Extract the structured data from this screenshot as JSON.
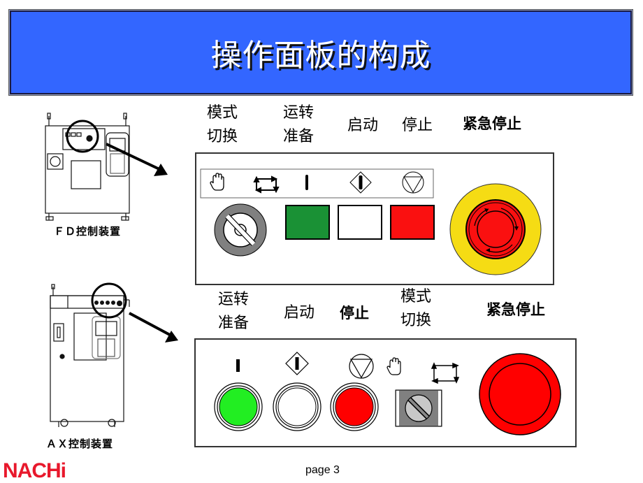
{
  "title": "操作面板的构成",
  "fd_section": {
    "caption": "ＦＤ控制装置",
    "labels": {
      "mode_switch": [
        "模式",
        "切换"
      ],
      "ready": [
        "运转",
        "准备"
      ],
      "start": "启动",
      "stop": "停止",
      "emergency_stop": "紧急停止"
    },
    "controls": [
      {
        "name": "mode-key-switch",
        "icon": "hand-icon",
        "color": "#808080"
      },
      {
        "name": "ready-button",
        "icon": "cycle-arrows-icon",
        "color": "#1a9135"
      },
      {
        "name": "start-button",
        "icon": "start-bar-icon",
        "color": "#ffffff"
      },
      {
        "name": "stop-button",
        "icon": "stop-triangle-icon",
        "color": "#fa1010"
      }
    ],
    "emergency": {
      "ring_color": "#f5dc14",
      "button_color": "#fa1010"
    }
  },
  "ax_section": {
    "caption": "ＡＸ控制装置",
    "labels": {
      "ready": [
        "运转",
        "准备"
      ],
      "start": "启动",
      "stop": "停止",
      "mode_switch": [
        "模式",
        "切换"
      ],
      "emergency_stop": "紧急停止"
    },
    "controls": [
      {
        "name": "ready-button",
        "color": "#22ee22"
      },
      {
        "name": "start-button",
        "color": "#ffffff"
      },
      {
        "name": "stop-button",
        "color": "#ff0000"
      },
      {
        "name": "mode-selector-switch",
        "color": "#808080"
      }
    ],
    "emergency": {
      "button_color": "#ff0000"
    }
  },
  "footer": {
    "logo": "NACHi",
    "page": "page 3"
  }
}
